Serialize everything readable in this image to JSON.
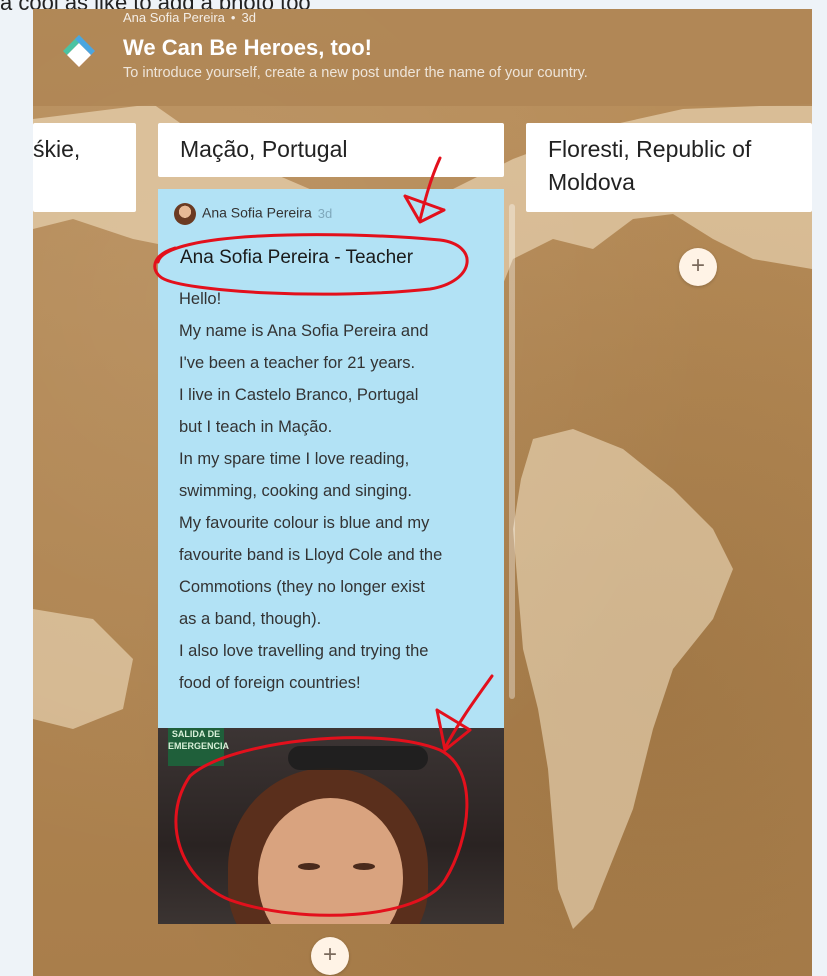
{
  "top_cut_text": "a cool as like to add a photo too",
  "board": {
    "author": "Ana Sofia Pereira",
    "author_time": "3d",
    "title": "We Can Be Heroes, too!",
    "description": "To introduce yourself, create a new post under the name of your country."
  },
  "columns": [
    {
      "title": "śkie,"
    },
    {
      "title": "Mação, Portugal"
    },
    {
      "title": "Floresti, Republic of Moldova"
    }
  ],
  "post": {
    "author": "Ana Sofia Pereira",
    "time": "3d",
    "title": "Ana Sofia Pereira - Teacher",
    "body_lines": [
      "Hello!",
      "My name is Ana Sofia Pereira and",
      "I've been a teacher for 21 years.",
      "I live in Castelo Branco, Portugal",
      "but I teach in Mação.",
      "In my spare time I love reading,",
      "swimming, cooking and singing.",
      "My favourite colour is blue and my",
      "favourite band is Lloyd Cole and the",
      "Commotions (they no longer exist",
      "as a band, though).",
      "I also love travelling and trying the",
      "food of foreign countries!"
    ],
    "photo_sign": "SALIDA DE EMERGENCIA"
  },
  "add_symbol": "+",
  "colors": {
    "header_bg": "#b08756",
    "post_bg": "#b2e2f5",
    "annotation": "#e3101c"
  }
}
